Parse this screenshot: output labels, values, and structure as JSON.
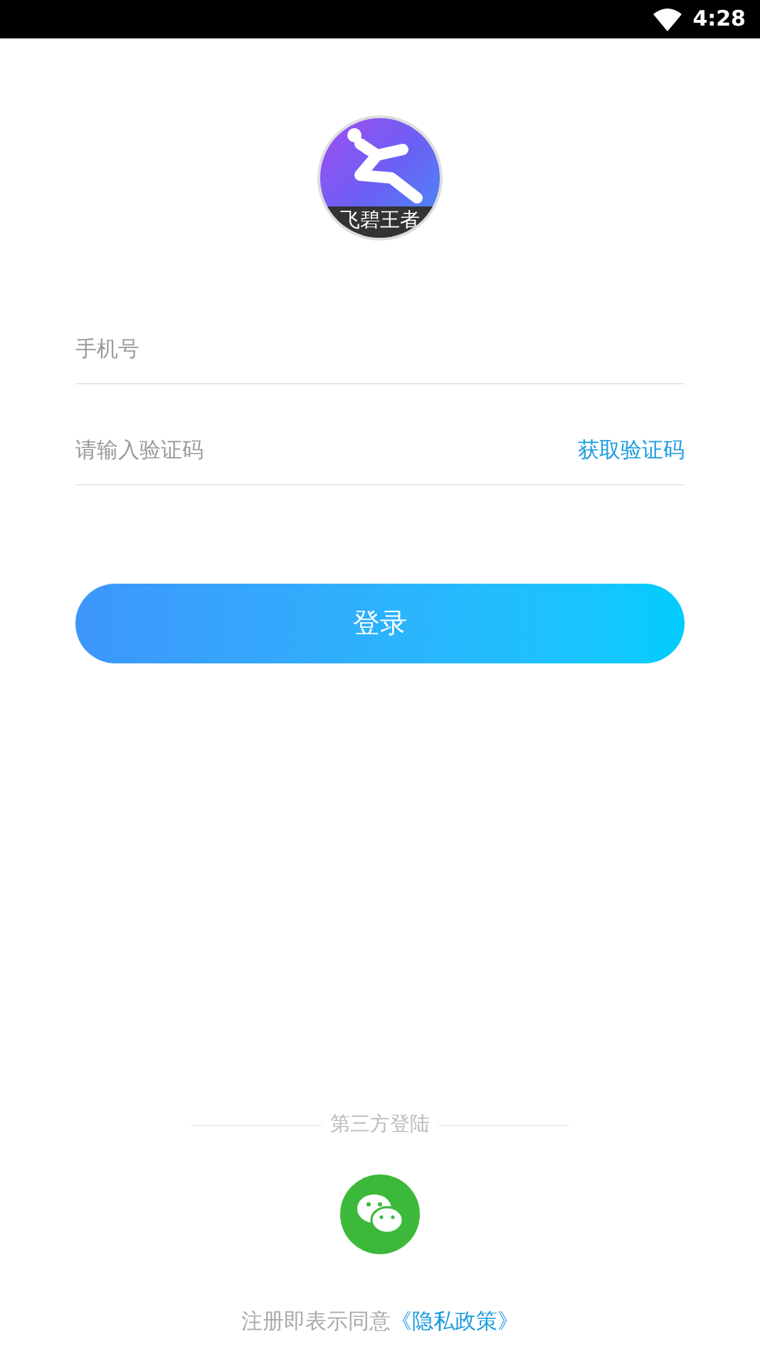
{
  "status_bar": {
    "time": "4:28"
  },
  "logo": {
    "caption": "飞碧王者"
  },
  "phone_field": {
    "placeholder": "手机号"
  },
  "code_field": {
    "placeholder": "请输入验证码",
    "action": "获取验证码"
  },
  "login_button": {
    "label": "登录"
  },
  "third_party": {
    "title": "第三方登陆"
  },
  "footer": {
    "text": "注册即表示同意",
    "link": "《隐私政策》"
  }
}
